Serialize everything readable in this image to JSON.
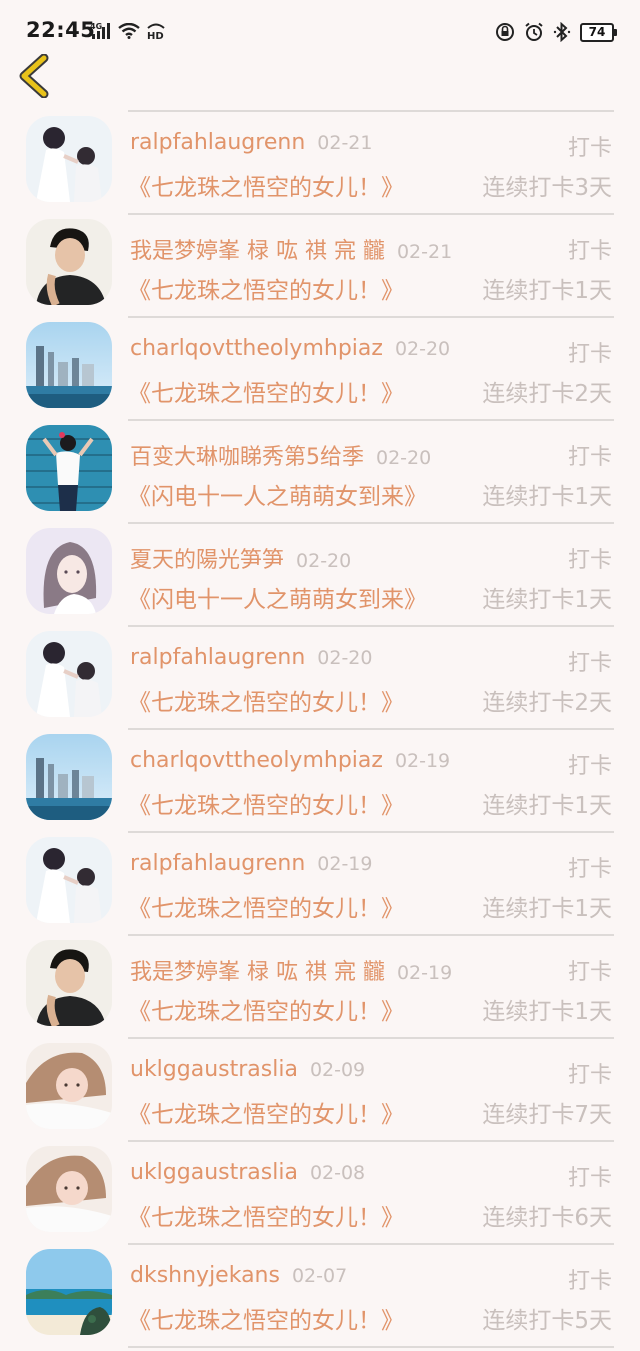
{
  "status": {
    "time": "22:45",
    "network": "4G",
    "hd": "HD",
    "battery": "74"
  },
  "rows": [
    {
      "name": "ralpfahlaugrenn",
      "date": "02-21",
      "checkin": "打卡",
      "book": "《七龙珠之悟空的女儿！》",
      "streak": "连续打卡3天",
      "avatar": "couple-avatar"
    },
    {
      "name": "我是梦婷峯 椂 吰 祺 宺 龖",
      "date": "02-21",
      "checkin": "打卡",
      "book": "《七龙珠之悟空的女儿！》",
      "streak": "连续打卡1天",
      "avatar": "man-avatar"
    },
    {
      "name": "charlqovttheolymhpiaz",
      "date": "02-20",
      "checkin": "打卡",
      "book": "《七龙珠之悟空的女儿！》",
      "streak": "连续打卡2天",
      "avatar": "city-avatar"
    },
    {
      "name": "百变大琳咖睇秀第5给季",
      "date": "02-20",
      "checkin": "打卡",
      "book": "《闪电十一人之萌萌女到来》",
      "streak": "连续打卡1天",
      "avatar": "girl-blue-avatar"
    },
    {
      "name": "夏天的陽光笋笋",
      "date": "02-20",
      "checkin": "打卡",
      "book": "《闪电十一人之萌萌女到来》",
      "streak": "连续打卡1天",
      "avatar": "anime-girl-avatar"
    },
    {
      "name": "ralpfahlaugrenn",
      "date": "02-20",
      "checkin": "打卡",
      "book": "《七龙珠之悟空的女儿！》",
      "streak": "连续打卡2天",
      "avatar": "couple-avatar"
    },
    {
      "name": "charlqovttheolymhpiaz",
      "date": "02-19",
      "checkin": "打卡",
      "book": "《七龙珠之悟空的女儿！》",
      "streak": "连续打卡1天",
      "avatar": "city-avatar"
    },
    {
      "name": "ralpfahlaugrenn",
      "date": "02-19",
      "checkin": "打卡",
      "book": "《七龙珠之悟空的女儿！》",
      "streak": "连续打卡1天",
      "avatar": "couple-avatar"
    },
    {
      "name": "我是梦婷峯 椂 吰 祺 宺 龖",
      "date": "02-19",
      "checkin": "打卡",
      "book": "《七龙珠之悟空的女儿！》",
      "streak": "连续打卡1天",
      "avatar": "man-avatar"
    },
    {
      "name": "uklggaustraslia",
      "date": "02-09",
      "checkin": "打卡",
      "book": "《七龙珠之悟空的女儿！》",
      "streak": "连续打卡7天",
      "avatar": "woman-avatar"
    },
    {
      "name": "uklggaustraslia",
      "date": "02-08",
      "checkin": "打卡",
      "book": "《七龙珠之悟空的女儿！》",
      "streak": "连续打卡6天",
      "avatar": "woman-avatar"
    },
    {
      "name": "dkshnyjekans",
      "date": "02-07",
      "checkin": "打卡",
      "book": "《七龙珠之悟空的女儿！》",
      "streak": "连续打卡5天",
      "avatar": "beach-avatar"
    }
  ],
  "icons": {
    "back": "back-chevron-icon"
  },
  "colors": {
    "accent": "#e1946a",
    "muted": "#c9c0bd",
    "back": "#e8c21a"
  }
}
